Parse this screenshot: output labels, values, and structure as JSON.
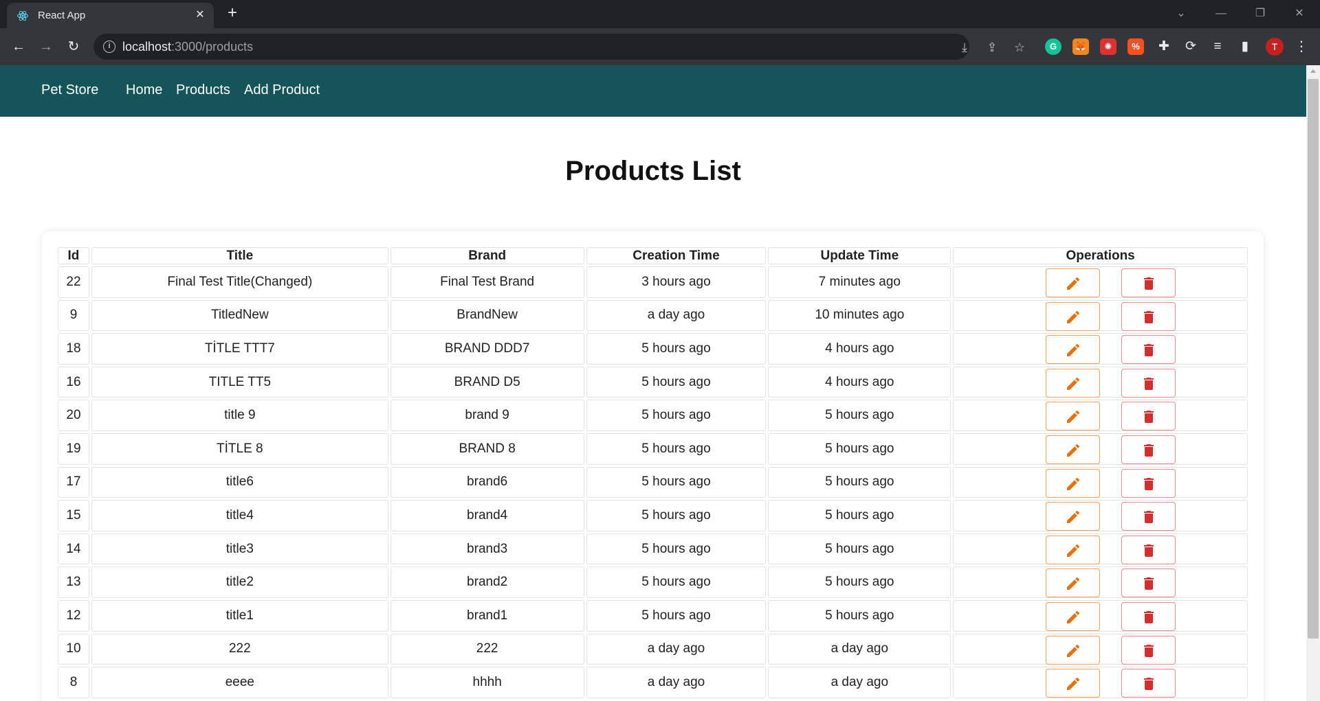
{
  "browser": {
    "tab_title": "React App",
    "url_host": "localhost",
    "url_path": ":3000/products",
    "profile_initial": "T"
  },
  "nav": {
    "brand": "Pet Store",
    "links": [
      "Home",
      "Products",
      "Add Product"
    ]
  },
  "page": {
    "title": "Products List"
  },
  "table": {
    "headers": [
      "Id",
      "Title",
      "Brand",
      "Creation Time",
      "Update Time",
      "Operations"
    ],
    "rows": [
      {
        "id": "22",
        "title": "Final Test Title(Changed)",
        "brand": "Final Test Brand",
        "created": "3 hours ago",
        "updated": "7 minutes ago"
      },
      {
        "id": "9",
        "title": "TitledNew",
        "brand": "BrandNew",
        "created": "a day ago",
        "updated": "10 minutes ago"
      },
      {
        "id": "18",
        "title": "TİTLE TTT7",
        "brand": "BRAND DDD7",
        "created": "5 hours ago",
        "updated": "4 hours ago"
      },
      {
        "id": "16",
        "title": "TITLE TT5",
        "brand": "BRAND D5",
        "created": "5 hours ago",
        "updated": "4 hours ago"
      },
      {
        "id": "20",
        "title": "title 9",
        "brand": "brand 9",
        "created": "5 hours ago",
        "updated": "5 hours ago"
      },
      {
        "id": "19",
        "title": "TİTLE 8",
        "brand": "BRAND 8",
        "created": "5 hours ago",
        "updated": "5 hours ago"
      },
      {
        "id": "17",
        "title": "title6",
        "brand": "brand6",
        "created": "5 hours ago",
        "updated": "5 hours ago"
      },
      {
        "id": "15",
        "title": "title4",
        "brand": "brand4",
        "created": "5 hours ago",
        "updated": "5 hours ago"
      },
      {
        "id": "14",
        "title": "title3",
        "brand": "brand3",
        "created": "5 hours ago",
        "updated": "5 hours ago"
      },
      {
        "id": "13",
        "title": "title2",
        "brand": "brand2",
        "created": "5 hours ago",
        "updated": "5 hours ago"
      },
      {
        "id": "12",
        "title": "title1",
        "brand": "brand1",
        "created": "5 hours ago",
        "updated": "5 hours ago"
      },
      {
        "id": "10",
        "title": "222",
        "brand": "222",
        "created": "a day ago",
        "updated": "a day ago"
      },
      {
        "id": "8",
        "title": "eeee",
        "brand": "hhhh",
        "created": "a day ago",
        "updated": "a day ago"
      }
    ]
  },
  "colors": {
    "navbar": "#155458",
    "edit_icon": "#e8710a",
    "delete_icon": "#d32f2f"
  },
  "icons": {
    "edit": "pencil-icon",
    "delete": "trash-icon"
  }
}
